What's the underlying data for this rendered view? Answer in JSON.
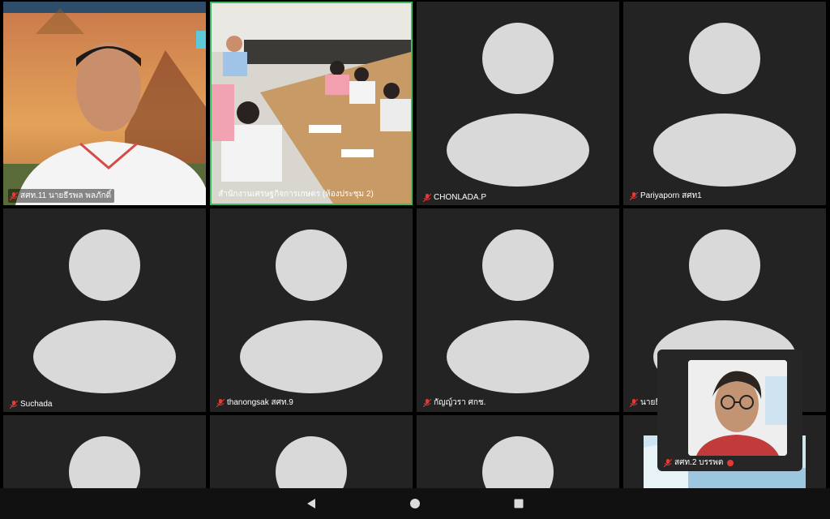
{
  "tiles": [
    {
      "name": "สศท.11 นายธีรพล พลภักดิ์",
      "type": "video-man"
    },
    {
      "name": "สำนักงานเศรษฐกิจการเกษตร (ห้องประชุม 2)",
      "type": "video-room",
      "active": true
    },
    {
      "name": "CHONLADA.P",
      "type": "avatar"
    },
    {
      "name": "Pariyaporn สศท1",
      "type": "avatar"
    },
    {
      "name": "Suchada",
      "type": "avatar"
    },
    {
      "name": "thanongsak สศท.9",
      "type": "avatar"
    },
    {
      "name": "กัญญ์วรา ศกช.",
      "type": "avatar"
    },
    {
      "name": "นายธี",
      "type": "avatar"
    }
  ],
  "self_view": {
    "name": "สศท.2 บรรพต"
  },
  "colors": {
    "tile_bg": "#232323",
    "avatar": "#d9d9d9",
    "active_border": "#3bbf5c",
    "muted_mic": "#e53935"
  },
  "nav": {
    "back": "back-icon",
    "home": "home-icon",
    "recents": "recents-icon"
  }
}
